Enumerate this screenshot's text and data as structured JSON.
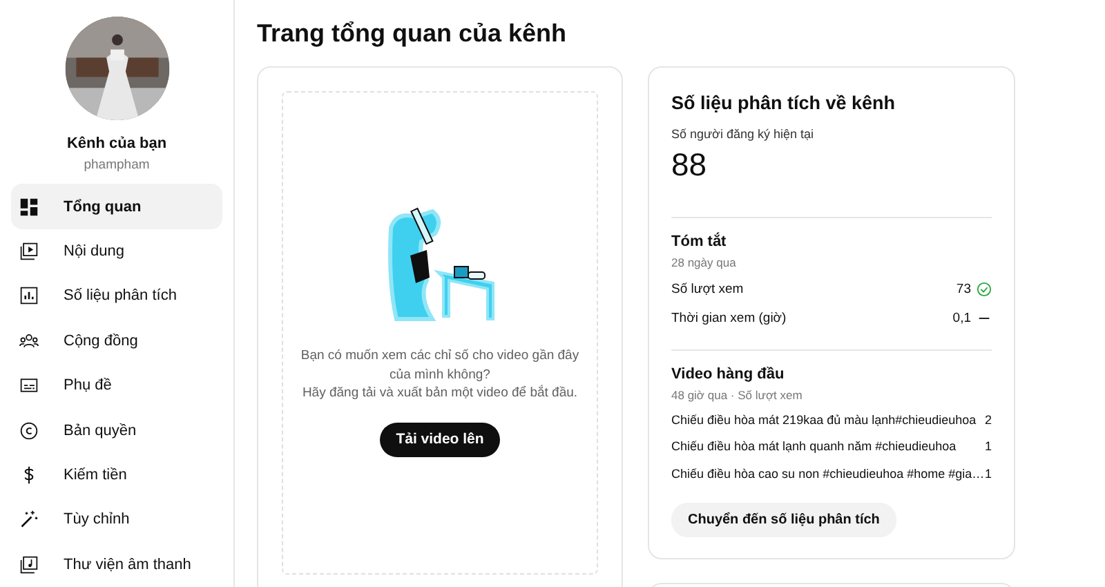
{
  "sidebar": {
    "channel_name": "Kênh của bạn",
    "handle": "phampham",
    "items": [
      {
        "label": "Tổng quan",
        "selected": true
      },
      {
        "label": "Nội dung",
        "selected": false
      },
      {
        "label": "Số liệu phân tích",
        "selected": false
      },
      {
        "label": "Cộng đồng",
        "selected": false
      },
      {
        "label": "Phụ đề",
        "selected": false
      },
      {
        "label": "Bản quyền",
        "selected": false
      },
      {
        "label": "Kiếm tiền",
        "selected": false
      },
      {
        "label": "Tùy chỉnh",
        "selected": false
      },
      {
        "label": "Thư viện âm thanh",
        "selected": false
      }
    ]
  },
  "page_title": "Trang tổng quan của kênh",
  "upload_card": {
    "message": "Bạn có muốn xem các chỉ số cho video gần đây của mình không?",
    "hint": "Hãy đăng tải và xuất bản một video để bắt đầu.",
    "button": "Tải video lên"
  },
  "analytics_card": {
    "title": "Số liệu phân tích về kênh",
    "subscribers_label": "Số người đăng ký hiện tại",
    "subscribers": "88",
    "summary": {
      "title": "Tóm tắt",
      "period": "28 ngày qua",
      "metrics": [
        {
          "label": "Số lượt xem",
          "value": "73"
        },
        {
          "label": "Thời gian xem (giờ)",
          "value": "0,1"
        }
      ]
    },
    "top_videos": {
      "title": "Video hàng đầu",
      "period": "48 giờ qua · Số lượt xem",
      "videos": [
        {
          "title": "Chiếu điều hòa mát 219kaa đủ màu lạnh#chieudieuhoa",
          "views": "2"
        },
        {
          "title": "Chiếu điều hòa mát lạnh quanh năm #chieudieuhoa",
          "views": "1"
        },
        {
          "title": "Chiếu điều hòa cao su non #chieudieuhoa #home #gia…",
          "views": "1"
        }
      ]
    },
    "button": "Chuyển đến số liệu phân tích"
  }
}
